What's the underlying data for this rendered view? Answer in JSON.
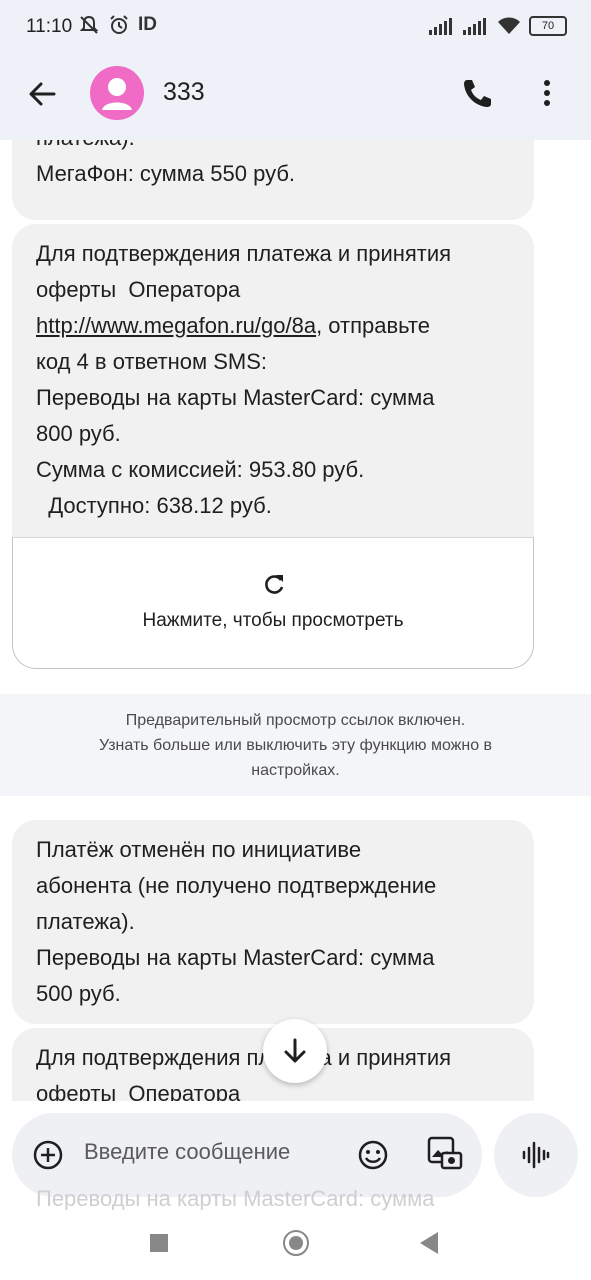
{
  "status_bar": {
    "time": "11:10",
    "carrier_indicator": "ID",
    "battery": "70",
    "icons": [
      "mute-icon",
      "alarm-icon",
      "signal-icon",
      "signal-icon",
      "wifi-icon",
      "battery-icon"
    ]
  },
  "header": {
    "contact_name": "333",
    "icons": [
      "back-arrow-icon",
      "avatar-person-icon",
      "phone-icon",
      "more-vert-icon"
    ]
  },
  "messages": [
    {
      "lines": [
        "платежа).",
        "МегаФон: сумма 550 руб."
      ]
    },
    {
      "line1": "Для подтверждения платежа и принятия",
      "line2": "оферты  Оператора",
      "link": "http://www.megafon.ru/go/8a",
      "line3_suffix": ", отправьте",
      "line4": "код 4 в ответном SMS:",
      "line5": "Переводы на карты MasterCard: сумма",
      "line6": "800 руб.",
      "line7": "Сумма с комиссией: 953.80 руб.",
      "line8": "  Доступно: 638.12 руб."
    },
    {
      "lines": [
        "Платёж отменён по инициативе",
        "абонента (не получено подтверждение",
        "платежа).",
        "Переводы на карты MasterCard: сумма",
        "500 руб."
      ]
    },
    {
      "lines": [
        "Для подтверждения платежа и принятия",
        "оферты  Оператора"
      ]
    }
  ],
  "link_preview": {
    "label": "Нажмите, чтобы просмотреть",
    "icon": "refresh-icon"
  },
  "preview_notice": {
    "line1": "Предварительный просмотр ссылок включен.",
    "line2": "Узнать больше или выключить эту функцию можно в",
    "line3": "настройках."
  },
  "compose": {
    "placeholder": "Введите сообщение",
    "ghost_text": "Переводы на карты MasterCard: сумма",
    "icons": [
      "add-circle-icon",
      "emoji-icon",
      "gallery-icon",
      "voice-icon"
    ]
  },
  "scroll_button_icon": "arrow-down-icon",
  "nav_bar": {
    "icons": [
      "recents-icon",
      "home-icon",
      "back-icon"
    ]
  },
  "colors": {
    "header_bg": "#eef1f8",
    "bubble_bg": "#f1f1f1",
    "avatar": "#f06bc6"
  }
}
